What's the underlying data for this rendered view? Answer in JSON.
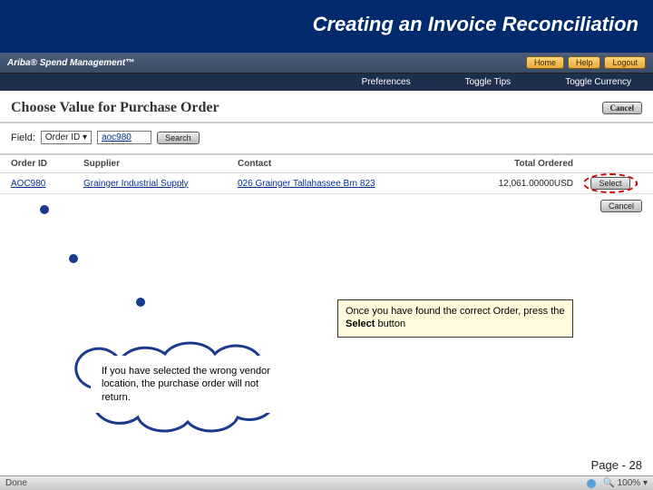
{
  "title": "Creating an Invoice Reconciliation",
  "app": {
    "brand": "Ariba® Spend Management™",
    "nav": {
      "home": "Home",
      "help": "Help",
      "logout": "Logout"
    },
    "menu": {
      "preferences": "Preferences",
      "tips": "Toggle Tips",
      "currency": "Toggle Currency"
    }
  },
  "panel": {
    "heading": "Choose Value for Purchase Order",
    "cancel": "Cancel",
    "field_label": "Field:",
    "field_value": "Order ID",
    "search_value": "aoc980",
    "search_btn": "Search"
  },
  "columns": {
    "c1": "Order ID",
    "c2": "Supplier",
    "c3": "Contact",
    "c4": "Total Ordered",
    "c5": ""
  },
  "row": {
    "order_id": "AOC980",
    "supplier": "Grainger Industrial Supply",
    "contact": "026  Grainger  Tallahassee Brn 823",
    "total": "12,061.00000USD",
    "select": "Select"
  },
  "callout_yellow_a": "Once you have found the correct  Order, press the ",
  "callout_yellow_b": "Select",
  "callout_yellow_c": " button",
  "cloud": "If you have selected the wrong vendor location, the purchase order will not return.",
  "footer": "Page - 28",
  "status": {
    "left": "Done",
    "zoom": "100%"
  }
}
